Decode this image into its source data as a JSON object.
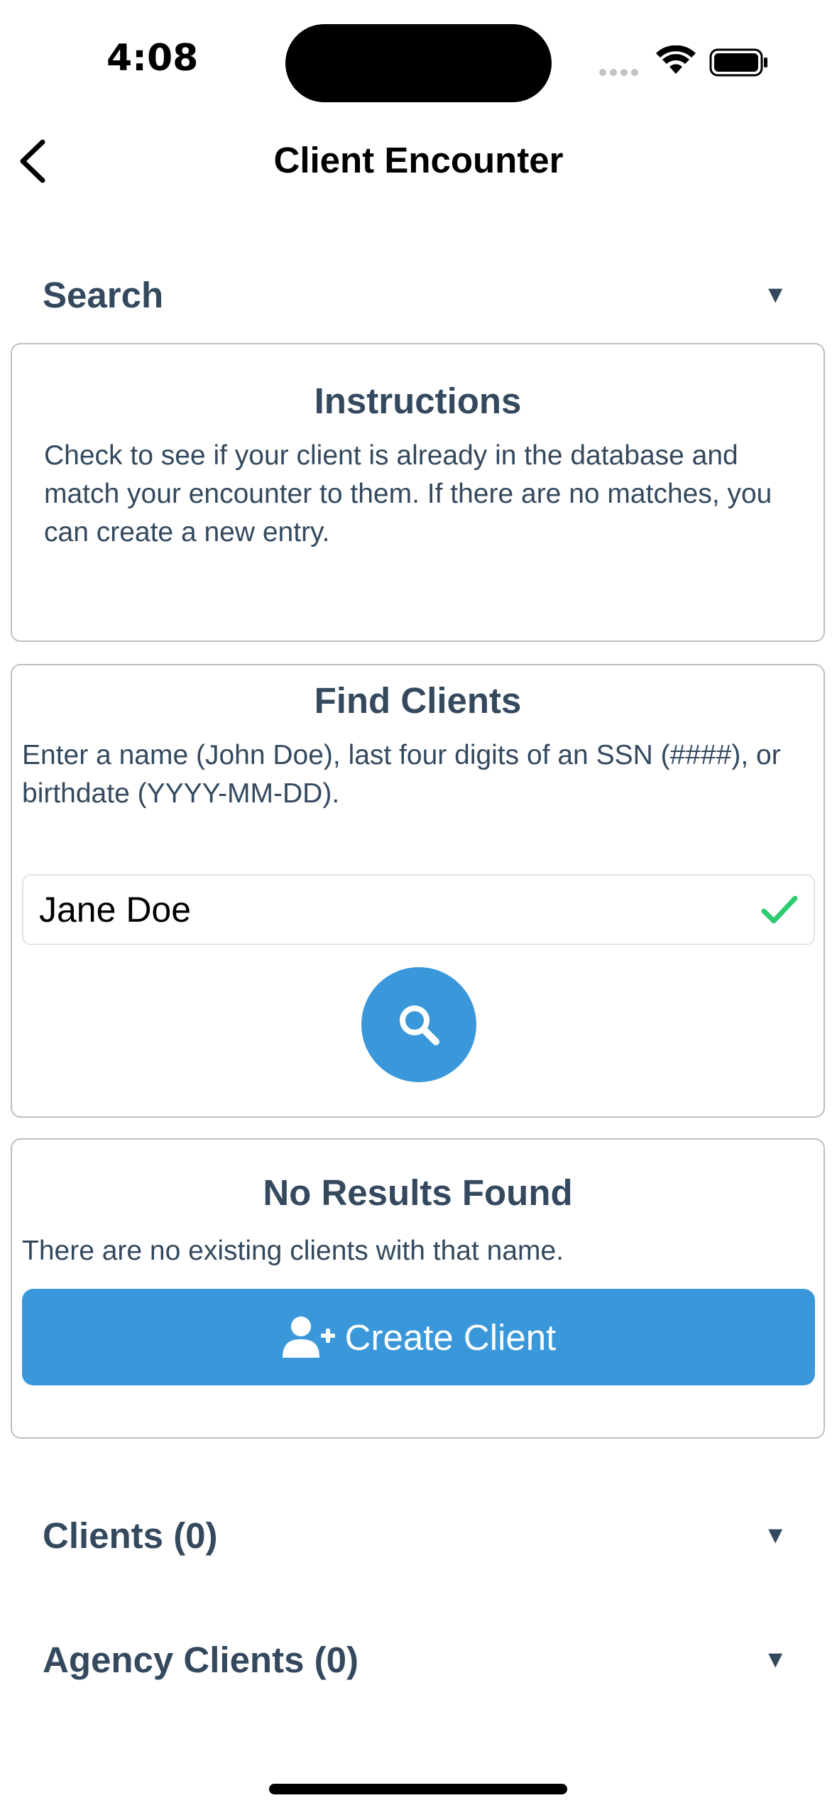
{
  "status_bar": {
    "time": "4:08"
  },
  "nav": {
    "title": "Client Encounter"
  },
  "search_section": {
    "label": "Search",
    "caret": "▼"
  },
  "instructions": {
    "title": "Instructions",
    "text": "Check to see if your client is already in the database and match your encounter to them. If there are no matches, you can create a new entry."
  },
  "find_clients": {
    "title": "Find Clients",
    "text": "Enter a name (John Doe), last four digits of an SSN (####), or birthdate (YYYY-MM-DD).",
    "input_value": "Jane Doe"
  },
  "no_results": {
    "title": "No Results Found",
    "text": "There are no existing clients with that name.",
    "create_label": "Create Client"
  },
  "clients_section": {
    "label": "Clients (0)",
    "caret": "▼"
  },
  "agency_clients_section": {
    "label": "Agency Clients (0)",
    "caret": "▼"
  },
  "colors": {
    "accent": "#3a98da",
    "text": "#34495e",
    "valid": "#2ecc71"
  }
}
